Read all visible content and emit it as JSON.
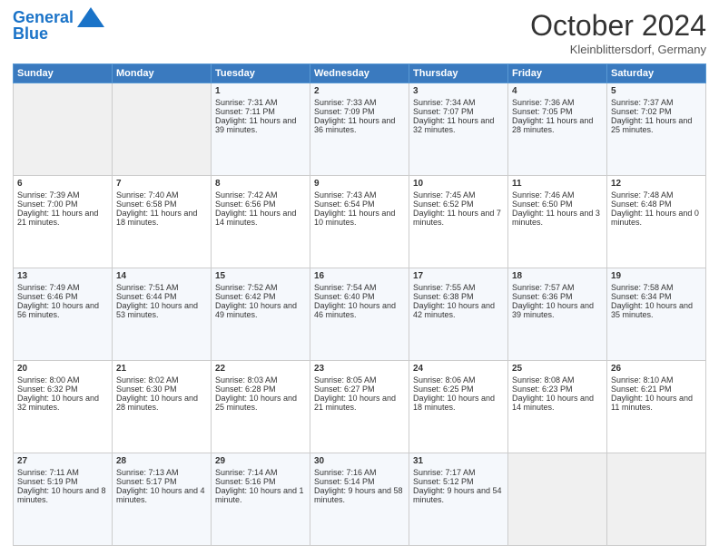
{
  "header": {
    "logo_line1": "General",
    "logo_line2": "Blue",
    "month": "October 2024",
    "location": "Kleinblittersdorf, Germany"
  },
  "days_of_week": [
    "Sunday",
    "Monday",
    "Tuesday",
    "Wednesday",
    "Thursday",
    "Friday",
    "Saturday"
  ],
  "rows": [
    [
      {
        "day": "",
        "sunrise": "",
        "sunset": "",
        "daylight": ""
      },
      {
        "day": "",
        "sunrise": "",
        "sunset": "",
        "daylight": ""
      },
      {
        "day": "1",
        "sunrise": "Sunrise: 7:31 AM",
        "sunset": "Sunset: 7:11 PM",
        "daylight": "Daylight: 11 hours and 39 minutes."
      },
      {
        "day": "2",
        "sunrise": "Sunrise: 7:33 AM",
        "sunset": "Sunset: 7:09 PM",
        "daylight": "Daylight: 11 hours and 36 minutes."
      },
      {
        "day": "3",
        "sunrise": "Sunrise: 7:34 AM",
        "sunset": "Sunset: 7:07 PM",
        "daylight": "Daylight: 11 hours and 32 minutes."
      },
      {
        "day": "4",
        "sunrise": "Sunrise: 7:36 AM",
        "sunset": "Sunset: 7:05 PM",
        "daylight": "Daylight: 11 hours and 28 minutes."
      },
      {
        "day": "5",
        "sunrise": "Sunrise: 7:37 AM",
        "sunset": "Sunset: 7:02 PM",
        "daylight": "Daylight: 11 hours and 25 minutes."
      }
    ],
    [
      {
        "day": "6",
        "sunrise": "Sunrise: 7:39 AM",
        "sunset": "Sunset: 7:00 PM",
        "daylight": "Daylight: 11 hours and 21 minutes."
      },
      {
        "day": "7",
        "sunrise": "Sunrise: 7:40 AM",
        "sunset": "Sunset: 6:58 PM",
        "daylight": "Daylight: 11 hours and 18 minutes."
      },
      {
        "day": "8",
        "sunrise": "Sunrise: 7:42 AM",
        "sunset": "Sunset: 6:56 PM",
        "daylight": "Daylight: 11 hours and 14 minutes."
      },
      {
        "day": "9",
        "sunrise": "Sunrise: 7:43 AM",
        "sunset": "Sunset: 6:54 PM",
        "daylight": "Daylight: 11 hours and 10 minutes."
      },
      {
        "day": "10",
        "sunrise": "Sunrise: 7:45 AM",
        "sunset": "Sunset: 6:52 PM",
        "daylight": "Daylight: 11 hours and 7 minutes."
      },
      {
        "day": "11",
        "sunrise": "Sunrise: 7:46 AM",
        "sunset": "Sunset: 6:50 PM",
        "daylight": "Daylight: 11 hours and 3 minutes."
      },
      {
        "day": "12",
        "sunrise": "Sunrise: 7:48 AM",
        "sunset": "Sunset: 6:48 PM",
        "daylight": "Daylight: 11 hours and 0 minutes."
      }
    ],
    [
      {
        "day": "13",
        "sunrise": "Sunrise: 7:49 AM",
        "sunset": "Sunset: 6:46 PM",
        "daylight": "Daylight: 10 hours and 56 minutes."
      },
      {
        "day": "14",
        "sunrise": "Sunrise: 7:51 AM",
        "sunset": "Sunset: 6:44 PM",
        "daylight": "Daylight: 10 hours and 53 minutes."
      },
      {
        "day": "15",
        "sunrise": "Sunrise: 7:52 AM",
        "sunset": "Sunset: 6:42 PM",
        "daylight": "Daylight: 10 hours and 49 minutes."
      },
      {
        "day": "16",
        "sunrise": "Sunrise: 7:54 AM",
        "sunset": "Sunset: 6:40 PM",
        "daylight": "Daylight: 10 hours and 46 minutes."
      },
      {
        "day": "17",
        "sunrise": "Sunrise: 7:55 AM",
        "sunset": "Sunset: 6:38 PM",
        "daylight": "Daylight: 10 hours and 42 minutes."
      },
      {
        "day": "18",
        "sunrise": "Sunrise: 7:57 AM",
        "sunset": "Sunset: 6:36 PM",
        "daylight": "Daylight: 10 hours and 39 minutes."
      },
      {
        "day": "19",
        "sunrise": "Sunrise: 7:58 AM",
        "sunset": "Sunset: 6:34 PM",
        "daylight": "Daylight: 10 hours and 35 minutes."
      }
    ],
    [
      {
        "day": "20",
        "sunrise": "Sunrise: 8:00 AM",
        "sunset": "Sunset: 6:32 PM",
        "daylight": "Daylight: 10 hours and 32 minutes."
      },
      {
        "day": "21",
        "sunrise": "Sunrise: 8:02 AM",
        "sunset": "Sunset: 6:30 PM",
        "daylight": "Daylight: 10 hours and 28 minutes."
      },
      {
        "day": "22",
        "sunrise": "Sunrise: 8:03 AM",
        "sunset": "Sunset: 6:28 PM",
        "daylight": "Daylight: 10 hours and 25 minutes."
      },
      {
        "day": "23",
        "sunrise": "Sunrise: 8:05 AM",
        "sunset": "Sunset: 6:27 PM",
        "daylight": "Daylight: 10 hours and 21 minutes."
      },
      {
        "day": "24",
        "sunrise": "Sunrise: 8:06 AM",
        "sunset": "Sunset: 6:25 PM",
        "daylight": "Daylight: 10 hours and 18 minutes."
      },
      {
        "day": "25",
        "sunrise": "Sunrise: 8:08 AM",
        "sunset": "Sunset: 6:23 PM",
        "daylight": "Daylight: 10 hours and 14 minutes."
      },
      {
        "day": "26",
        "sunrise": "Sunrise: 8:10 AM",
        "sunset": "Sunset: 6:21 PM",
        "daylight": "Daylight: 10 hours and 11 minutes."
      }
    ],
    [
      {
        "day": "27",
        "sunrise": "Sunrise: 7:11 AM",
        "sunset": "Sunset: 5:19 PM",
        "daylight": "Daylight: 10 hours and 8 minutes."
      },
      {
        "day": "28",
        "sunrise": "Sunrise: 7:13 AM",
        "sunset": "Sunset: 5:17 PM",
        "daylight": "Daylight: 10 hours and 4 minutes."
      },
      {
        "day": "29",
        "sunrise": "Sunrise: 7:14 AM",
        "sunset": "Sunset: 5:16 PM",
        "daylight": "Daylight: 10 hours and 1 minute."
      },
      {
        "day": "30",
        "sunrise": "Sunrise: 7:16 AM",
        "sunset": "Sunset: 5:14 PM",
        "daylight": "Daylight: 9 hours and 58 minutes."
      },
      {
        "day": "31",
        "sunrise": "Sunrise: 7:17 AM",
        "sunset": "Sunset: 5:12 PM",
        "daylight": "Daylight: 9 hours and 54 minutes."
      },
      {
        "day": "",
        "sunrise": "",
        "sunset": "",
        "daylight": ""
      },
      {
        "day": "",
        "sunrise": "",
        "sunset": "",
        "daylight": ""
      }
    ]
  ]
}
